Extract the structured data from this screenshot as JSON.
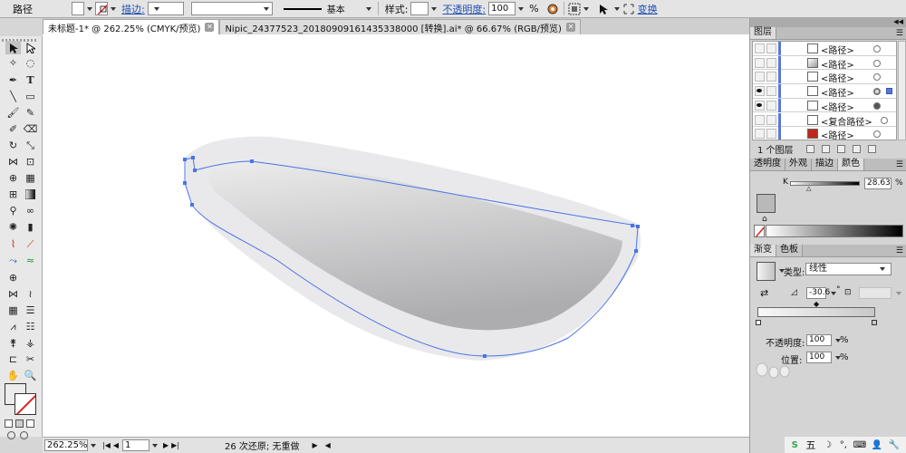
{
  "control_bar": {
    "tool_label": "路径",
    "stroke_label": "描边:",
    "line_profile": "基本",
    "style_label": "样式:",
    "opacity_label": "不透明度:",
    "opacity_value": "100",
    "opacity_unit": "%",
    "transform_label": "变换"
  },
  "tabs": [
    {
      "label": "未标题-1* @ 262.25% (CMYK/预览)",
      "active": true
    },
    {
      "label": "Nipic_24377523_20180909161435338000 [转换].ai* @ 66.67% (RGB/预览)",
      "active": false
    }
  ],
  "status_bar": {
    "zoom": "262.25%",
    "page": "1",
    "message": "26 次还原; 无重做"
  },
  "layers_panel": {
    "title": "图层",
    "rows": [
      {
        "name": "<路径>",
        "visible": false
      },
      {
        "name": "<路径>",
        "visible": false
      },
      {
        "name": "<路径>",
        "visible": false
      },
      {
        "name": "<路径>",
        "visible": true,
        "selected": true
      },
      {
        "name": "<路径>",
        "visible": true
      },
      {
        "name": "<复合路径>",
        "visible": false
      },
      {
        "name": "<路径>",
        "visible": false
      }
    ],
    "footer": "1 个图层"
  },
  "color_panel": {
    "tabs": [
      "透明度",
      "外观",
      "描边",
      "颜色"
    ],
    "active_tab": "颜色",
    "channel": "K",
    "k_value": "28.63",
    "unit": "%"
  },
  "gradient_panel": {
    "tabs": [
      "渐变",
      "色板"
    ],
    "active_tab": "渐变",
    "type_label": "类型:",
    "type_value": "线性",
    "angle_value": "-30.6",
    "degree": "°",
    "opacity_label": "不透明度:",
    "opacity_value": "100",
    "location_label": "位置:",
    "location_value": "100",
    "unit": "%"
  },
  "tray": {
    "ime_label": "五"
  },
  "colors": {
    "path_blue": "#4a73e6",
    "shape_light": "#e9e9ec",
    "shape_dark": "#b3b3b5",
    "layer_blue": "#5a78d6",
    "link_blue": "#1f4fb5"
  }
}
